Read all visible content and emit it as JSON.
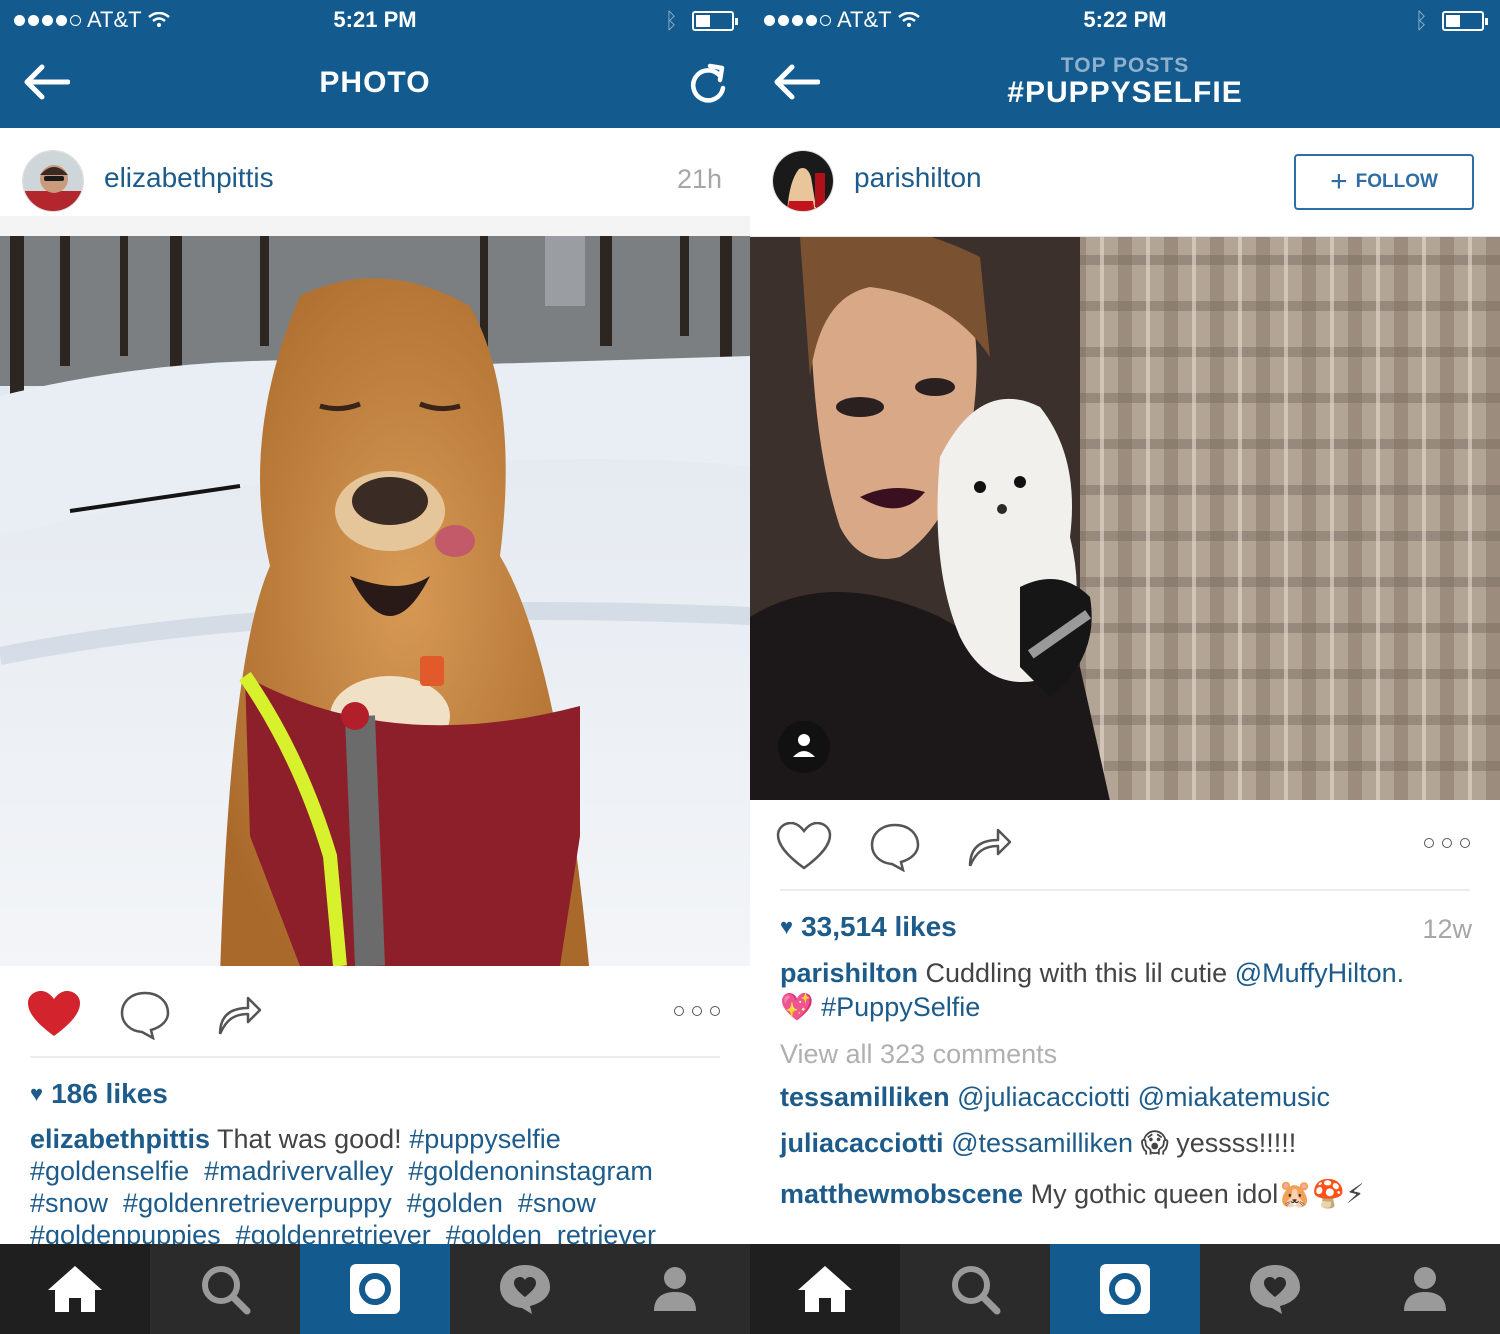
{
  "left_screen": {
    "status": {
      "carrier": "AT&T",
      "time": "5:21 PM"
    },
    "nav": {
      "title": "PHOTO"
    },
    "post": {
      "username": "elizabethpittis",
      "time_ago": "21h",
      "likes": "186 likes",
      "caption_user": "elizabethpittis",
      "caption_text": "That was good!",
      "hashtags_line1": "#puppyselfie",
      "hashtags_line2": "#goldenselfie  #madrivervalley  #goldenoninstagram",
      "hashtags_line3": "#snow  #goldenretrieverpuppy  #golden  #snow",
      "hashtags_line4": "#goldenpuppies  #goldenretriever  #golden_retriever"
    }
  },
  "right_screen": {
    "status": {
      "carrier": "AT&T",
      "time": "5:22 PM"
    },
    "nav": {
      "subtitle": "TOP POSTS",
      "title": "#PUPPYSELFIE"
    },
    "post": {
      "username": "parishilton",
      "follow_label": "FOLLOW",
      "likes": "33,514 likes",
      "time_ago": "12w",
      "caption_user": "parishilton",
      "caption_text": "Cuddling with this lil cutie",
      "caption_mention": "@MuffyHilton.",
      "caption_emoji": "💖",
      "caption_hashtag": "#PuppySelfie",
      "view_all": "View all 323 comments",
      "comments": [
        {
          "user": "tessamilliken",
          "text": "@juliacacciotti @miakatemusic",
          "extra": ""
        },
        {
          "user": "juliacacciotti",
          "text": "@tessamilliken",
          "extra": "😱  yessss!!!!!"
        },
        {
          "user": "matthewmobscene",
          "text": "",
          "extra": "My gothic queen idol🐹🍄⚡"
        }
      ]
    }
  },
  "tabs": [
    "home",
    "explore",
    "camera",
    "activity",
    "profile"
  ],
  "colors": {
    "brand": "#135a8e",
    "link": "#1d5b8a",
    "liked": "#d3242d"
  }
}
